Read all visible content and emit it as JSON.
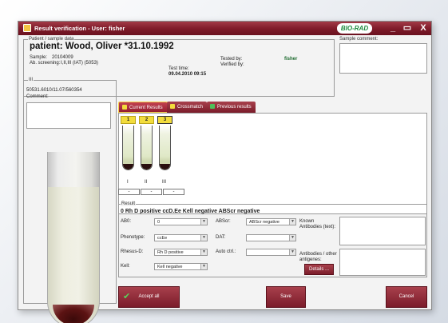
{
  "window": {
    "title": "Result verification - User: fisher",
    "logo": "BIO-RAD",
    "controls": [
      "_",
      "▭",
      "X"
    ]
  },
  "patient_panel": {
    "group_label": "Patient / sample data",
    "name": "patient: Wood, Oliver *31.10.1992",
    "sample_label": "Sample:",
    "sample_value": "20104009",
    "screening_label": "Ab. screening:",
    "screening_value": "I,II,III (IAT) (5053)",
    "test_time_label": "Test time:",
    "test_time_value": "09.04.2010 09:15",
    "tested_by_label": "Tested by:",
    "tested_by_value": "fisher",
    "verified_by_label": "Verified by:",
    "verified_by_value": ""
  },
  "sample_comment": {
    "label": "Sample comment:",
    "value": ""
  },
  "left_panel": {
    "group_label": "III",
    "card_id": "50531.6010/11.07/560354",
    "comment_label": "Comment:",
    "comment_value": ""
  },
  "tabs": [
    {
      "label": "Current Results",
      "active": true
    },
    {
      "label": "Crossmatch",
      "active": false
    },
    {
      "label": "Previous results",
      "active": false
    }
  ],
  "wells": [
    {
      "number": "1",
      "roman": "I",
      "reaction": "-"
    },
    {
      "number": "2",
      "roman": "II",
      "reaction": "-"
    },
    {
      "number": "3",
      "roman": "III",
      "reaction": "-"
    }
  ],
  "result": {
    "group_label": "Result",
    "summary": "0 Rh D positive ccD.Ee Kell negative ABScr negative",
    "fields": {
      "abo": {
        "label": "AB0:",
        "value": "0"
      },
      "phenotype": {
        "label": "Phenotype:",
        "value": "ccEe"
      },
      "rhesus": {
        "label": "Rhesus-D:",
        "value": "Rh D positive"
      },
      "kell": {
        "label": "Kell:",
        "value": "Kell negative"
      },
      "abscr": {
        "label": "ABScr:",
        "value": "ABScr negative"
      },
      "dat": {
        "label": "DAT:",
        "value": ""
      },
      "autoctrl": {
        "label": "Auto ctrl.:",
        "value": ""
      }
    },
    "known_antibodies_label": "Known Antibodies (text):",
    "other_antigenes_label": "Antibodies / other antigenes:",
    "details_button": "Details ..."
  },
  "footer": {
    "accept_all": "Accept all",
    "save": "Save",
    "cancel": "Cancel"
  },
  "colors": {
    "brand_dark": "#7e1a28",
    "accent_yellow": "#f2dc3c",
    "logo_green": "#1c8a3c"
  }
}
